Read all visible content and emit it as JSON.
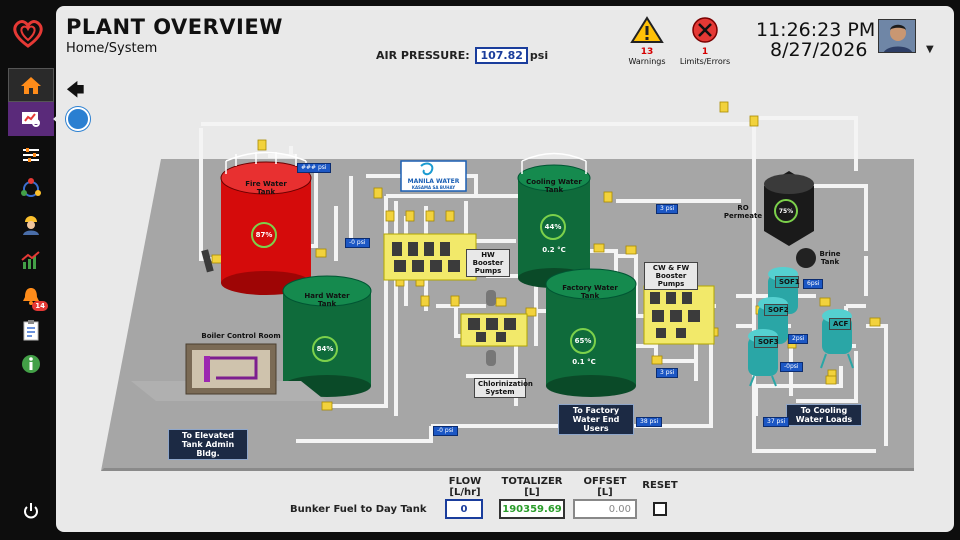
{
  "header": {
    "title": "PLANT OVERVIEW",
    "breadcrumb": "Home/System",
    "air_pressure_label": "AIR PRESSURE:",
    "air_pressure_value": "107.82",
    "air_pressure_unit": "psi"
  },
  "alarms": {
    "warnings_count": "13",
    "warnings_label": "Warnings",
    "errors_count": "1",
    "errors_label": "Limits/Errors"
  },
  "clock": {
    "time": "11:26:23 PM",
    "date": "8/27/2026"
  },
  "sidebar": {
    "items": [
      {
        "icon": "home-icon"
      },
      {
        "icon": "monitor-icon"
      },
      {
        "icon": "sliders-icon"
      },
      {
        "icon": "cycle-icon"
      },
      {
        "icon": "worker-icon"
      },
      {
        "icon": "chart-icon"
      },
      {
        "icon": "bell-icon",
        "badge": "14"
      },
      {
        "icon": "clipboard-icon"
      },
      {
        "icon": "info-icon"
      },
      {
        "icon": "power-icon"
      }
    ]
  },
  "plant": {
    "fire_tank": {
      "label": "Fire Water Tank",
      "level": "87%"
    },
    "hard_tank": {
      "label": "Hard Water Tank",
      "level": "84%"
    },
    "cooling_tank": {
      "label": "Cooling Water Tank",
      "level": "44%",
      "temp": "0.2 °C"
    },
    "factory_tank": {
      "label": "Factory Water Tank",
      "level": "65%",
      "temp": "0.1 °C"
    },
    "ro_tank": {
      "label": "RO Permeate",
      "level": "75%"
    },
    "brine_tank": {
      "label": "Brine Tank"
    },
    "boiler": "Boiler Control Room",
    "hw_booster": "HW Booster Pumps",
    "cw_booster": "CW & FW Booster Pumps",
    "chlorination": "Chlorinization System",
    "manila_water": "MANILA WATER",
    "manila_water_tag": "KASAMA SA BUHAY",
    "sof1": "SOF1",
    "sof2": "SOF2",
    "sof3": "SOF3",
    "acf": "ACF",
    "to_elevated": "To Elevated Tank Admin Bldg.",
    "to_factory": "To Factory Water End Users",
    "to_cooling": "To Cooling Water Loads",
    "psi": {
      "fire": "### psi",
      "hard": "-0 psi",
      "cooling": "3 psi",
      "sof1": "6psi",
      "sof2": "2psi",
      "sof3": "-0psi",
      "factory_a": "3 psi",
      "factory_b": "38 psi",
      "cooling_b": "37 psi",
      "elevated": "-0 psi"
    }
  },
  "bunker": {
    "flow_header": "FLOW",
    "flow_unit": "[L/hr]",
    "totalizer_header": "TOTALIZER",
    "totalizer_unit": "[L]",
    "offset_header": "OFFSET",
    "offset_unit": "[L]",
    "reset_header": "RESET",
    "row_label": "Bunker Fuel to Day Tank",
    "flow": "0",
    "totalizer": "190359.69",
    "offset": "0.00"
  },
  "colors": {
    "fire_tank": "#d50b0b",
    "green_tank": "#0f6b3b",
    "pipe": "#f4f4f4",
    "platform": "#a6a6a6",
    "accent": "#1c2a44"
  }
}
